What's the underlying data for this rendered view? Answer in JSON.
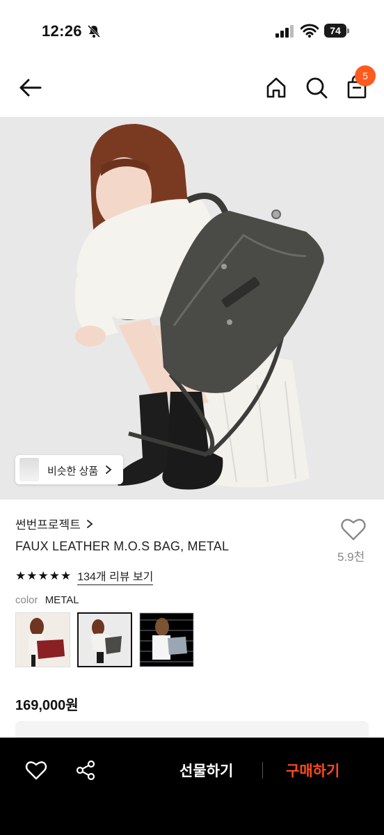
{
  "status_bar": {
    "time": "12:26",
    "battery": "74"
  },
  "nav": {
    "cart_count": "5"
  },
  "hero": {
    "similar_label": "비슷한 상품"
  },
  "product": {
    "brand": "썬번프로젝트",
    "title": "FAUX LEATHER M.O.S BAG, METAL",
    "like_count": "5.9천",
    "rating_stars": "★★★★★",
    "review_link": "134개 리뷰 보기",
    "color_label": "color",
    "color_value": "METAL",
    "swatches": [
      {
        "name": "burgundy",
        "color": "#8a1f24"
      },
      {
        "name": "metal",
        "color": "#4a4a48",
        "selected": true
      },
      {
        "name": "grey-blue",
        "color": "#7d8a96"
      }
    ],
    "price": "169,000원"
  },
  "bottom_bar": {
    "gift_label": "선물하기",
    "buy_label": "구매하기",
    "buy_color": "#ff4a1c"
  },
  "colors": {
    "accent": "#ff5a1f",
    "hero_bg": "#e8e8e8"
  }
}
